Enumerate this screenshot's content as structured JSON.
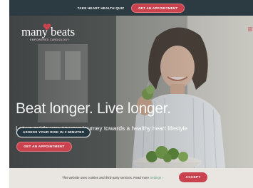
{
  "topbar": {
    "quiz_link": "TAKE HEART HEALTH QUIZ",
    "appointment_button": "GET AN APPOINTMENT"
  },
  "logo": {
    "wordmark": "many beats",
    "tagline": "EMPOWERED CARDIOLOGY"
  },
  "header": {
    "menu_icon": "hamburger-icon"
  },
  "hero": {
    "headline": "Beat longer. Live longer.",
    "subheadline": "Let us guide you on your journey towards a healthy heart lifestyle",
    "assess_button": "ASSESS YOUR RISK IN 2 MINUTES",
    "appointment_button": "GET AN APPOINTMENT",
    "image_description_icon": "photo-woman-eating-salad"
  },
  "cookie_banner": {
    "text": "This website uses cookies and third-party services. Read more",
    "settings_link": "Settings ›",
    "accept_button": "ACCEPT"
  },
  "colors": {
    "brand_red": "#c9424e",
    "dark_navy": "#233740",
    "topbar_bg": "#2c3a42",
    "cookie_bg": "#e9e6e1",
    "link_teal": "#5a9b8a"
  }
}
